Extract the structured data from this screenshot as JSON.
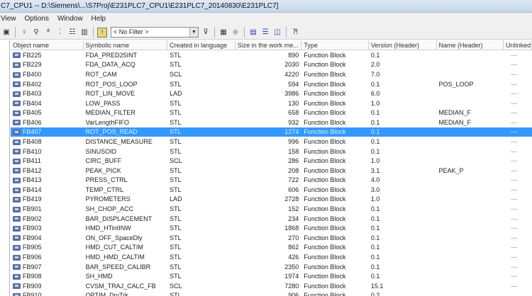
{
  "window": {
    "title": "C7_CPU1 -- D:\\Siemens\\...\\S7Proj\\E231PLC7_CPU1\\E231PLC7_20140830\\E231PLC7]"
  },
  "menu": [
    "View",
    "Options",
    "Window",
    "Help"
  ],
  "toolbar": {
    "filter_value": "< No Filter >",
    "icons": [
      "network-icon",
      "list-icon",
      "details-icon",
      "large-icons-icon",
      "small-icons-icon",
      "columns-icon",
      "up-folder-icon",
      "filter-icon",
      "simulation-icon",
      "online-icon",
      "cascade-icon",
      "tile-horizontal-icon",
      "tile-vertical-icon",
      "help-icon"
    ]
  },
  "colors": {
    "selection": "#3399ff"
  },
  "table": {
    "columns": [
      "Object name",
      "Symbolic name",
      "Created in language",
      "Size in the work me...",
      "Type",
      "Version (Header)",
      "Name (Header)",
      "Unlinked"
    ],
    "selected_index": 8,
    "rows": [
      [
        "FB225",
        "FDA_PRED25INT",
        "STL",
        "890",
        "Function Block",
        "0.1",
        "",
        "---"
      ],
      [
        "FB229",
        "FDA_DATA_ACQ",
        "STL",
        "2030",
        "Function Block",
        "2.0",
        "",
        "---"
      ],
      [
        "FB400",
        "ROT_CAM",
        "SCL",
        "4220",
        "Function Block",
        "7.0",
        "",
        "---"
      ],
      [
        "FB402",
        "ROT_POS_LOOP",
        "STL",
        "594",
        "Function Block",
        "0.1",
        "POS_LOOP",
        "---"
      ],
      [
        "FB403",
        "ROT_LIN_MOVE",
        "LAD",
        "3986",
        "Function Block",
        "6.0",
        "",
        "---"
      ],
      [
        "FB404",
        "LOW_PASS",
        "STL",
        "130",
        "Function Block",
        "1.0",
        "",
        "---"
      ],
      [
        "FB405",
        "MEDIAN_FILTER",
        "STL",
        "658",
        "Function Block",
        "0.1",
        "MEDIAN_F",
        "---"
      ],
      [
        "FB406",
        "VarLengthFIFO",
        "STL",
        "932",
        "Function Block",
        "0.1",
        "MEDIAN_F",
        "---"
      ],
      [
        "FB407",
        "ROT_POS_READ",
        "STL",
        "1274",
        "Function Block",
        "0.1",
        "",
        "---"
      ],
      [
        "FB408",
        "DISTANCE_MEASURE",
        "STL",
        "996",
        "Function Block",
        "0.1",
        "",
        "---"
      ],
      [
        "FB410",
        "SINUSOID",
        "STL",
        "158",
        "Function Block",
        "0.1",
        "",
        "---"
      ],
      [
        "FB411",
        "CIRC_BUFF",
        "SCL",
        "286",
        "Function Block",
        "1.0",
        "",
        "---"
      ],
      [
        "FB412",
        "PEAK_PICK",
        "STL",
        "208",
        "Function Block",
        "3.1",
        "PEAK_P",
        "---"
      ],
      [
        "FB413",
        "PRESS_CTRL",
        "STL",
        "722",
        "Function Block",
        "4.0",
        "",
        "---"
      ],
      [
        "FB414",
        "TEMP_CTRL",
        "STL",
        "606",
        "Function Block",
        "3.0",
        "",
        "---"
      ],
      [
        "FB419",
        "PYROMETERS",
        "LAD",
        "2728",
        "Function Block",
        "1.0",
        "",
        "---"
      ],
      [
        "FB901",
        "SH_CHOP_ACC",
        "STL",
        "152",
        "Function Block",
        "0.1",
        "",
        "---"
      ],
      [
        "FB902",
        "BAR_DISPLACEMENT",
        "STL",
        "234",
        "Function Block",
        "0.1",
        "",
        "---"
      ],
      [
        "FB903",
        "HMD_HTintINW",
        "STL",
        "1868",
        "Function Block",
        "0.1",
        "",
        "---"
      ],
      [
        "FB904",
        "ON_OFF_SpaceDly",
        "STL",
        "270",
        "Function Block",
        "0.1",
        "",
        "---"
      ],
      [
        "FB905",
        "HMD_CUT_CALTIM",
        "STL",
        "862",
        "Function Block",
        "0.1",
        "",
        "---"
      ],
      [
        "FB906",
        "HMD_HMD_CALTIM",
        "STL",
        "426",
        "Function Block",
        "0.1",
        "",
        "---"
      ],
      [
        "FB907",
        "BAR_SPEED_CALIBR",
        "STL",
        "2350",
        "Function Block",
        "0.1",
        "",
        "---"
      ],
      [
        "FB908",
        "SH_HMD",
        "STL",
        "1974",
        "Function Block",
        "0.1",
        "",
        "---"
      ],
      [
        "FB909",
        "CVSM_TRAJ_CALC_FB",
        "SCL",
        "7280",
        "Function Block",
        "15.1",
        "",
        "---"
      ],
      [
        "FB910",
        "OPTIM_DrvTrk",
        "STL",
        "906",
        "Function Block",
        "0.2",
        "",
        ""
      ]
    ]
  }
}
